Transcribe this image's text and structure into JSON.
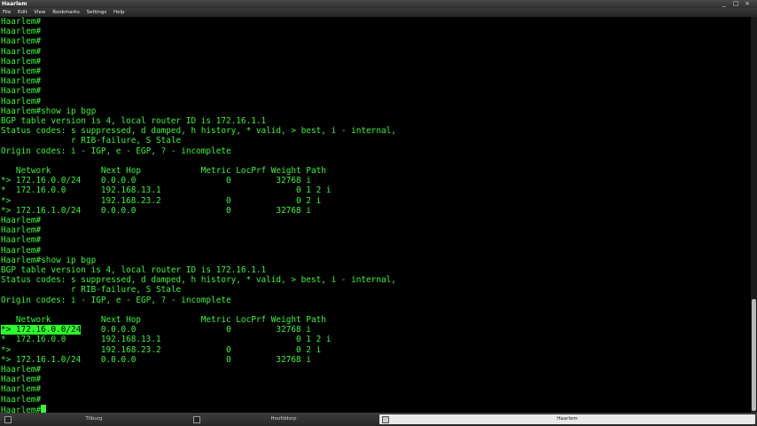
{
  "window": {
    "title": "Haarlem",
    "controls": [
      "_",
      "□",
      "×"
    ]
  },
  "menu": [
    "File",
    "Edit",
    "View",
    "Bookmarks",
    "Settings",
    "Help"
  ],
  "terminal": {
    "lines": [
      "Haarlem#",
      "Haarlem#",
      "Haarlem#",
      "Haarlem#",
      "Haarlem#",
      "Haarlem#",
      "Haarlem#",
      "Haarlem#",
      "Haarlem#",
      "Haarlem#show ip bgp",
      "BGP table version is 4, local router ID is 172.16.1.1",
      "Status codes: s suppressed, d damped, h history, * valid, > best, i - internal,",
      "              r RIB-failure, S Stale",
      "Origin codes: i - IGP, e - EGP, ? - incomplete",
      "",
      "   Network          Next Hop            Metric LocPrf Weight Path",
      "*> 172.16.0.0/24    0.0.0.0                  0         32768 i",
      "*  172.16.0.0       192.168.13.1                           0 1 2 i",
      "*>                  192.168.23.2             0             0 2 i",
      "*> 172.16.1.0/24    0.0.0.0                  0         32768 i",
      "Haarlem#",
      "Haarlem#",
      "Haarlem#",
      "Haarlem#",
      "Haarlem#show ip bgp",
      "BGP table version is 4, local router ID is 172.16.1.1",
      "Status codes: s suppressed, d damped, h history, * valid, > best, i - internal,",
      "              r RIB-failure, S Stale",
      "Origin codes: i - IGP, e - EGP, ? - incomplete",
      "",
      "   Network          Next Hop            Metric LocPrf Weight Path",
      "",
      "*  172.16.0.0       192.168.13.1                           0 1 2 i",
      "*>                  192.168.23.2             0             0 2 i",
      "*> 172.16.1.0/24    0.0.0.0                  0         32768 i",
      "Haarlem#",
      "Haarlem#",
      "Haarlem#",
      "Haarlem#"
    ],
    "selected_line": {
      "highlight": "*> 172.16.0.0/24",
      "rest": "    0.0.0.0                  0         32768 i"
    },
    "prompt": "Haarlem#"
  },
  "taskbar": {
    "tabs": [
      {
        "label": "Tilburg",
        "active": false
      },
      {
        "label": "Hoofddorp",
        "active": false
      },
      {
        "label": "Haarlem",
        "active": true
      }
    ]
  },
  "colors": {
    "terminal_fg": "#3cf23c",
    "terminal_bg": "#000000",
    "selection": "#2cff2c"
  }
}
